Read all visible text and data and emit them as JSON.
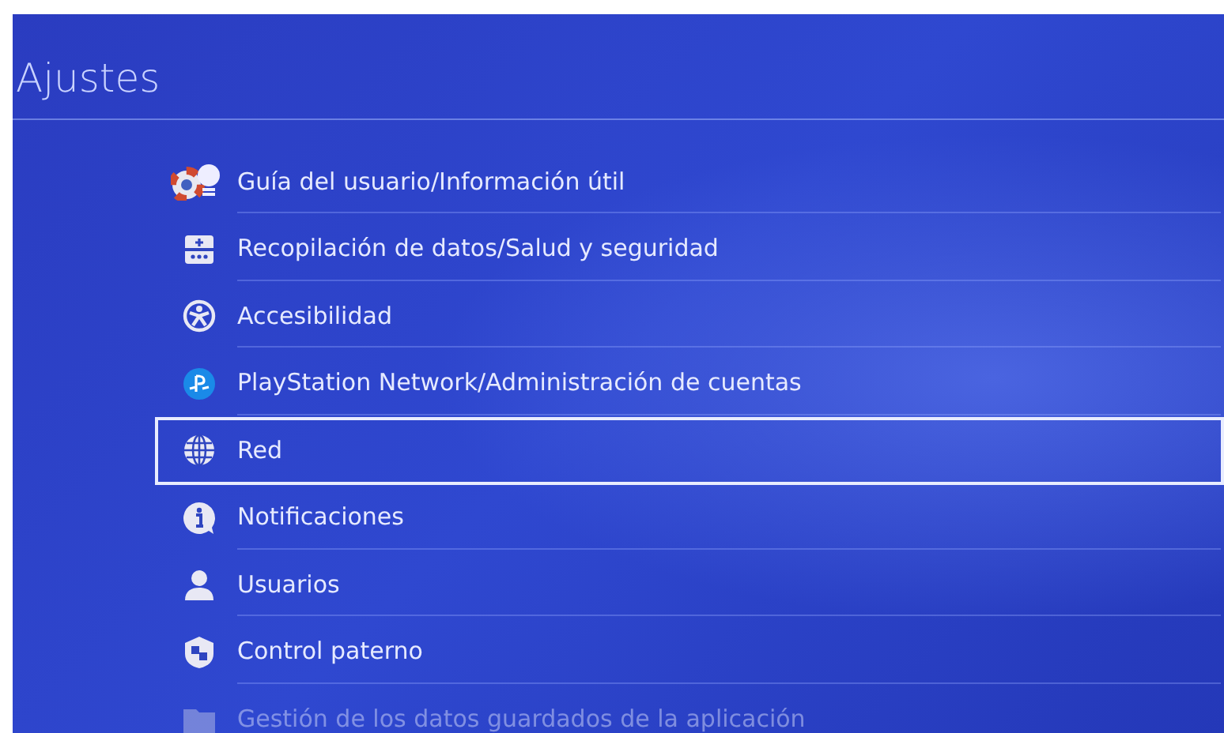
{
  "title": "Ajustes",
  "items": [
    {
      "label": "Guía del usuario/Información útil",
      "selected": false,
      "dimmed": false
    },
    {
      "label": "Recopilación de datos/Salud y seguridad",
      "selected": false,
      "dimmed": false
    },
    {
      "label": "Accesibilidad",
      "selected": false,
      "dimmed": false
    },
    {
      "label": "PlayStation Network/Administración de cuentas",
      "selected": false,
      "dimmed": false
    },
    {
      "label": "Red",
      "selected": true,
      "dimmed": false
    },
    {
      "label": "Notificaciones",
      "selected": false,
      "dimmed": false
    },
    {
      "label": "Usuarios",
      "selected": false,
      "dimmed": false
    },
    {
      "label": "Control paterno",
      "selected": false,
      "dimmed": false
    },
    {
      "label": "Gestión de los datos guardados de la aplicación",
      "selected": false,
      "dimmed": true
    }
  ]
}
